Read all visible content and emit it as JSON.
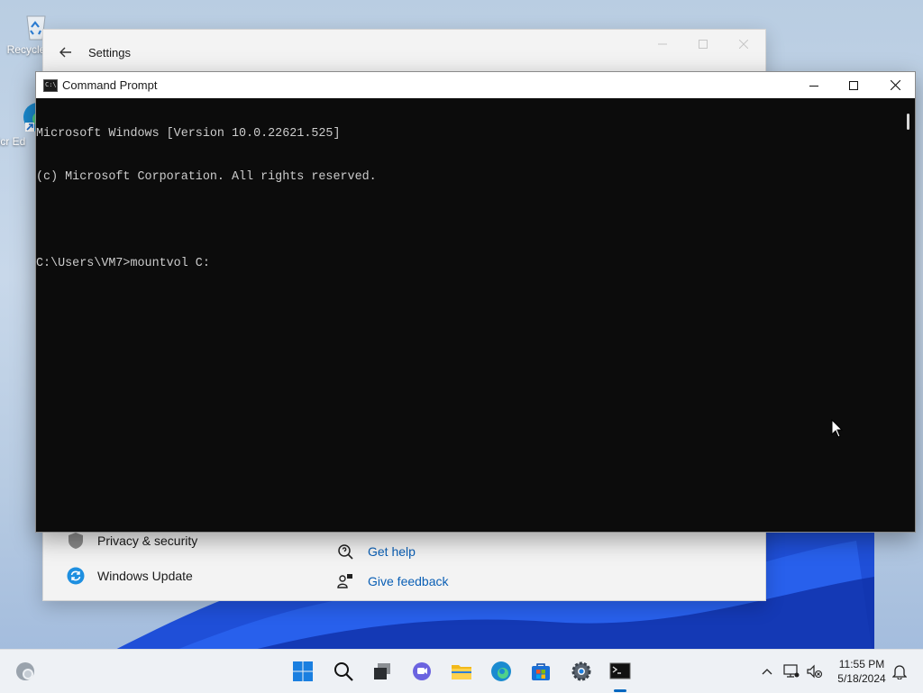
{
  "desktop": {
    "icons": [
      {
        "label": "Recycle",
        "icon": "recycle-bin-icon"
      },
      {
        "label": "Micr Ed",
        "icon": "edge-shortcut-icon"
      }
    ]
  },
  "settings_window": {
    "title": "Settings",
    "nav_items": [
      {
        "label": "Privacy & security",
        "icon": "shield-icon"
      },
      {
        "label": "Windows Update",
        "icon": "update-icon"
      }
    ],
    "links": [
      {
        "label": "Get help",
        "icon": "help-icon"
      },
      {
        "label": "Give feedback",
        "icon": "feedback-icon"
      }
    ]
  },
  "cmd_window": {
    "title": "Command Prompt",
    "icon_text": "C:\\",
    "lines": [
      "Microsoft Windows [Version 10.0.22621.525]",
      "(c) Microsoft Corporation. All rights reserved.",
      "",
      "C:\\Users\\VM7>mountvol C:"
    ],
    "text_color": "#cccccc",
    "background": "#0c0c0c"
  },
  "taskbar": {
    "apps": [
      "windows-start-icon",
      "search-icon",
      "task-view-icon",
      "chat-icon",
      "file-explorer-icon",
      "edge-icon",
      "store-icon",
      "settings-gear-icon",
      "terminal-icon"
    ],
    "active_app": "terminal-icon",
    "tray_icons": [
      "chevron-up-icon",
      "network-icon",
      "volume-muted-icon"
    ],
    "clock": {
      "time": "11:55 PM",
      "date": "5/18/2024"
    },
    "accent": "#0067c0"
  }
}
